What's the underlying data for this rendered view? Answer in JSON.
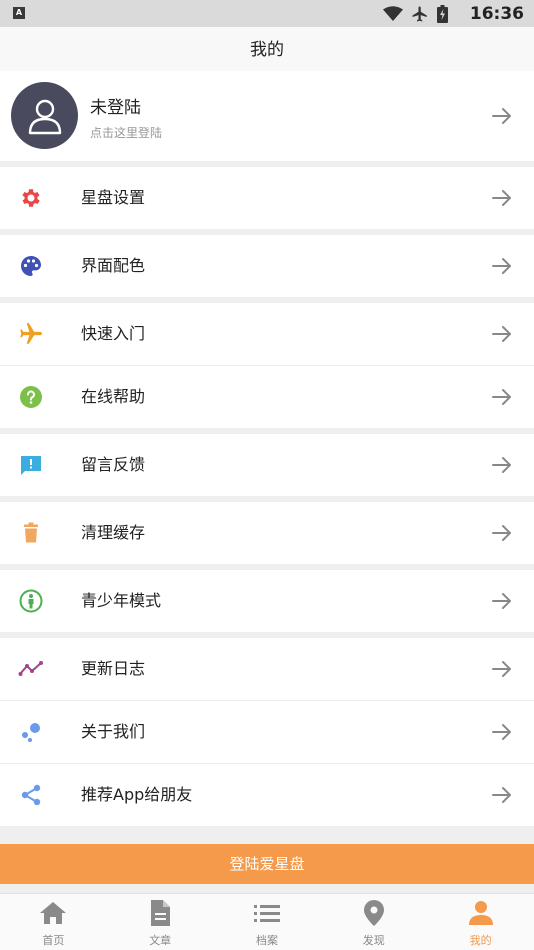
{
  "status_bar": {
    "indicator": "A",
    "time": "16:36"
  },
  "header": {
    "title": "我的"
  },
  "profile": {
    "name": "未登陆",
    "subtitle": "点击这里登陆"
  },
  "menu": [
    {
      "label": "星盘设置",
      "icon": "gear-icon",
      "color": "#e8474a"
    },
    {
      "label": "界面配色",
      "icon": "palette-icon",
      "color": "#3f51b5"
    },
    {
      "label": "快速入门",
      "icon": "airplane-icon",
      "color": "#f0a020"
    },
    {
      "label": "在线帮助",
      "icon": "help-circle-icon",
      "color": "#7cc04a"
    },
    {
      "label": "留言反馈",
      "icon": "feedback-icon",
      "color": "#3aaee0"
    },
    {
      "label": "清理缓存",
      "icon": "trash-icon",
      "color": "#f0a860"
    },
    {
      "label": "青少年模式",
      "icon": "child-icon",
      "color": "#4caf50"
    },
    {
      "label": "更新日志",
      "icon": "trend-icon",
      "color": "#a0468a"
    },
    {
      "label": "关于我们",
      "icon": "bubbles-icon",
      "color": "#6a9ae8"
    },
    {
      "label": "推荐App给朋友",
      "icon": "share-icon",
      "color": "#6a9ae8"
    }
  ],
  "login_button": "登陆爱星盘",
  "tabs": [
    {
      "label": "首页",
      "icon": "home-icon"
    },
    {
      "label": "文章",
      "icon": "document-icon"
    },
    {
      "label": "档案",
      "icon": "list-icon"
    },
    {
      "label": "发现",
      "icon": "location-pin-icon"
    },
    {
      "label": "我的",
      "icon": "person-icon",
      "active": true
    }
  ],
  "colors": {
    "accent": "#f5994a",
    "tab_inactive": "#888888",
    "arrow": "#888888"
  }
}
